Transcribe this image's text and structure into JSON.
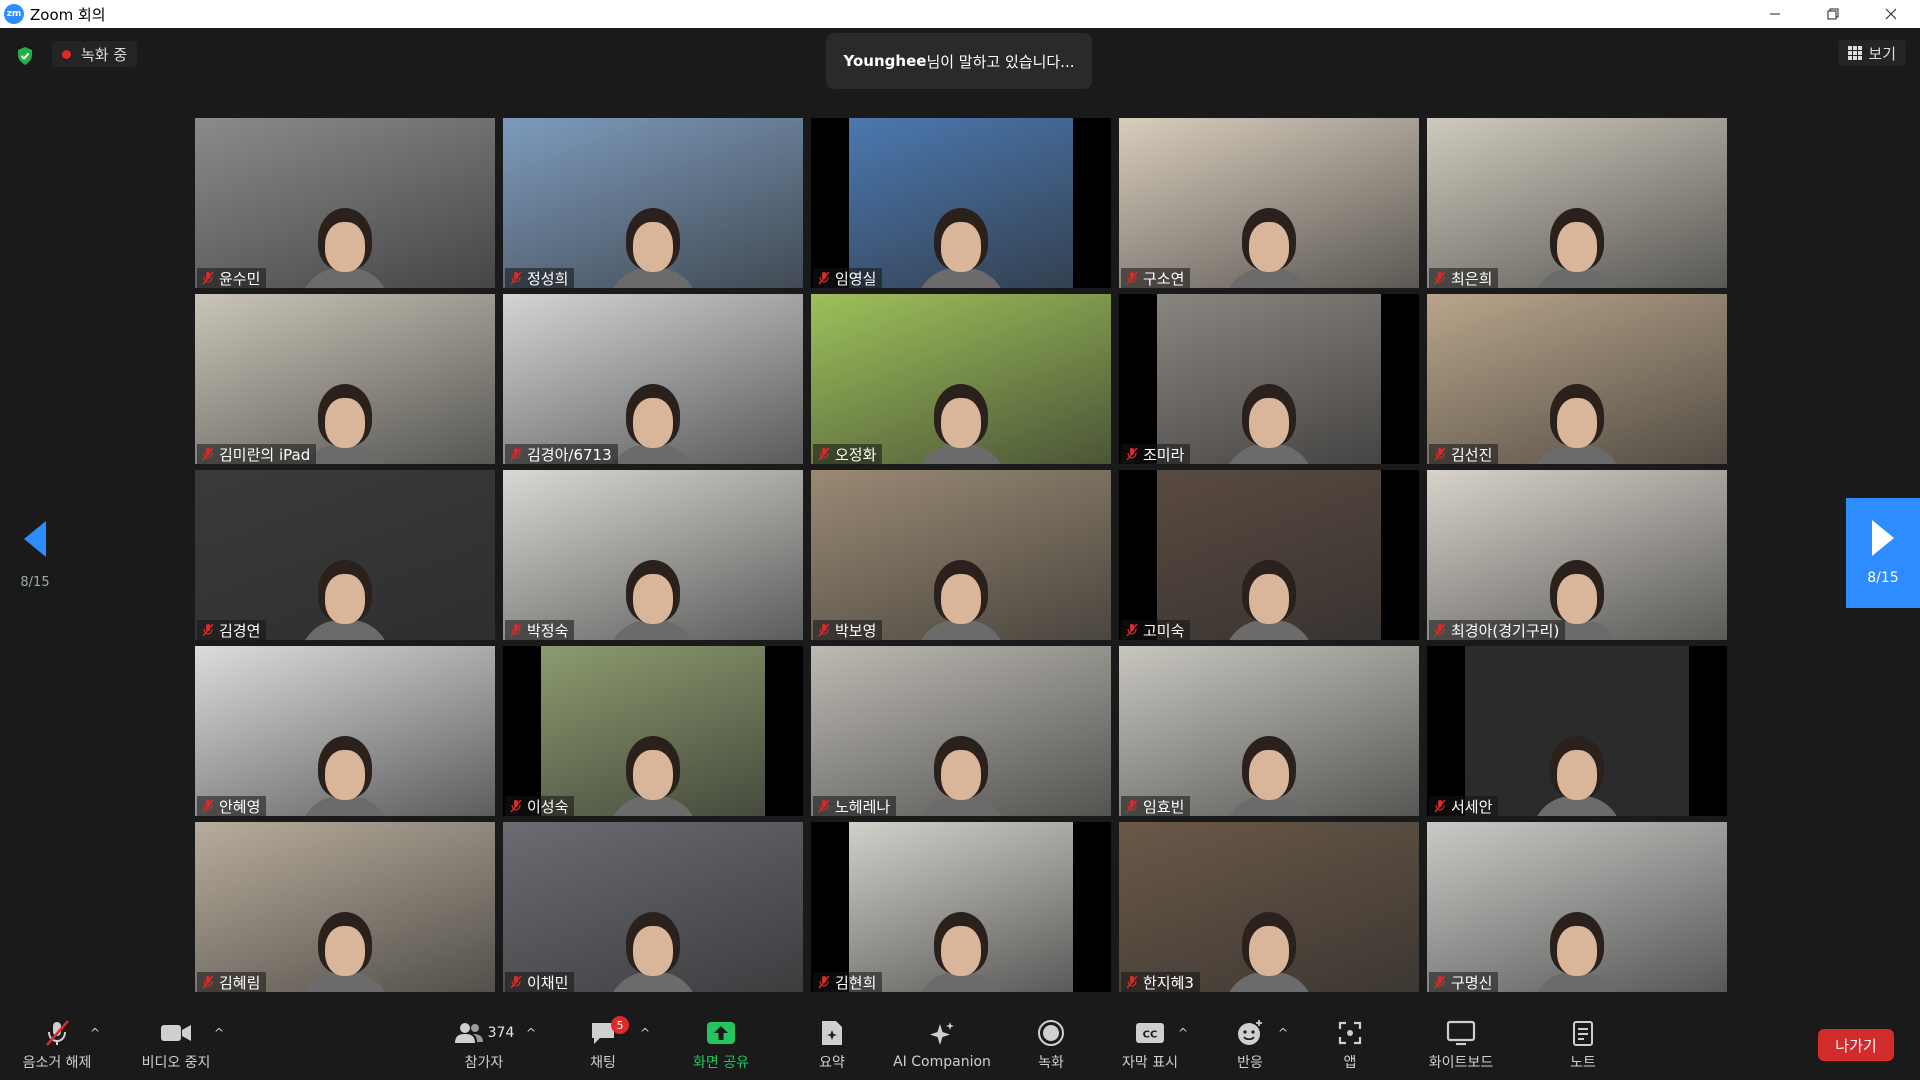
{
  "window": {
    "title": "Zoom 회의",
    "logo_text": "zm"
  },
  "top": {
    "recording_label": "녹화 중",
    "speaking_name": "Younghee",
    "speaking_suffix": "님이 말하고 있습니다...",
    "view_label": "보기"
  },
  "pagination": {
    "left_label": "8/15",
    "right_label": "8/15"
  },
  "participants": [
    {
      "name": "윤수민",
      "bg": "#8b8b8b"
    },
    {
      "name": "정성희",
      "bg": "#7d9bbd"
    },
    {
      "name": "임영실",
      "bg": "#4b78b0"
    },
    {
      "name": "구소연",
      "bg": "#d8cdbd"
    },
    {
      "name": "최은희",
      "bg": "#cfcabd"
    },
    {
      "name": "김미란의 iPad",
      "bg": "#c9c5b8"
    },
    {
      "name": "김경아/6713",
      "bg": "#d2d4d6"
    },
    {
      "name": "오정화",
      "bg": "#9ec15a"
    },
    {
      "name": "조미라",
      "bg": "#8a8580"
    },
    {
      "name": "김선진",
      "bg": "#b9a58a"
    },
    {
      "name": "김경연",
      "bg": "#3a3a3a"
    },
    {
      "name": "박정숙",
      "bg": "#d8d8d4"
    },
    {
      "name": "박보영",
      "bg": "#9a8a74"
    },
    {
      "name": "고미숙",
      "bg": "#5a4a40"
    },
    {
      "name": "최경아(경기구리)",
      "bg": "#d7d3cb"
    },
    {
      "name": "안혜영",
      "bg": "#dcdcdc"
    },
    {
      "name": "이성숙",
      "bg": "#8c9b6e"
    },
    {
      "name": "노헤레나",
      "bg": "#bdbab3"
    },
    {
      "name": "임효빈",
      "bg": "#c8c6bf"
    },
    {
      "name": "서세안",
      "bg": "#2c2c2c"
    },
    {
      "name": "김혜림",
      "bg": "#b8ad9c"
    },
    {
      "name": "이채민",
      "bg": "#6a6c72"
    },
    {
      "name": "김현희",
      "bg": "#d2d0cb"
    },
    {
      "name": "한지혜3",
      "bg": "#6a5848"
    },
    {
      "name": "구명신",
      "bg": "#c9c9c6"
    }
  ],
  "toolbar": {
    "unmute_label": "음소거 해제",
    "video_label": "비디오 중지",
    "participants_label": "참가자",
    "participants_count": "374",
    "chat_label": "채팅",
    "chat_badge": "5",
    "share_label": "화면 공유",
    "summary_label": "요약",
    "ai_label": "AI Companion",
    "record_label": "녹화",
    "caption_label": "자막 표시",
    "reaction_label": "반응",
    "apps_label": "앱",
    "whiteboard_label": "화이트보드",
    "notes_label": "노트",
    "leave_label": "나가기"
  },
  "colors": {
    "accent": "#2d8cff",
    "leave": "#d12b2b",
    "share": "#22c55e",
    "recording_dot": "#e02828"
  }
}
